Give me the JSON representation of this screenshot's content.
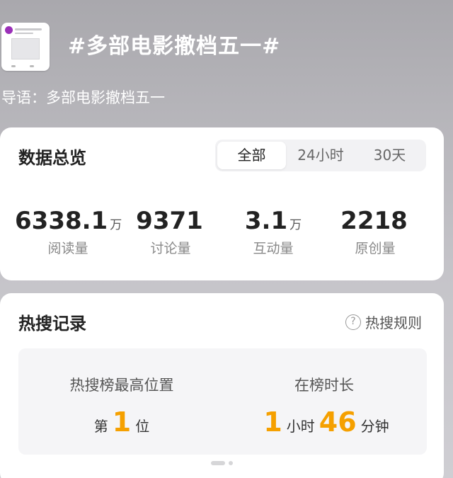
{
  "topic": {
    "title": "#多部电影撤档五一#",
    "intro": "导语：多部电影撤档五一"
  },
  "overview": {
    "title": "数据总览",
    "tabs": [
      {
        "label": "全部",
        "active": true
      },
      {
        "label": "24小时",
        "active": false
      },
      {
        "label": "30天",
        "active": false
      }
    ],
    "stats": [
      {
        "value": "6338.1",
        "unit": "万",
        "label": "阅读量"
      },
      {
        "value": "9371",
        "unit": "",
        "label": "讨论量"
      },
      {
        "value": "3.1",
        "unit": "万",
        "label": "互动量"
      },
      {
        "value": "2218",
        "unit": "",
        "label": "原创量"
      }
    ]
  },
  "hot_search": {
    "title": "热搜记录",
    "rules_label": "热搜规则",
    "rules_icon": "question-circle-icon",
    "peak": {
      "label": "热搜榜最高位置",
      "prefix": "第",
      "value": "1",
      "suffix": "位"
    },
    "duration": {
      "label": "在榜时长",
      "hours": "1",
      "hours_unit": "小时",
      "minutes": "46",
      "minutes_unit": "分钟"
    }
  },
  "colors": {
    "accent": "#f5a000",
    "background_top": "#a9a8ad",
    "card": "#ffffff"
  }
}
